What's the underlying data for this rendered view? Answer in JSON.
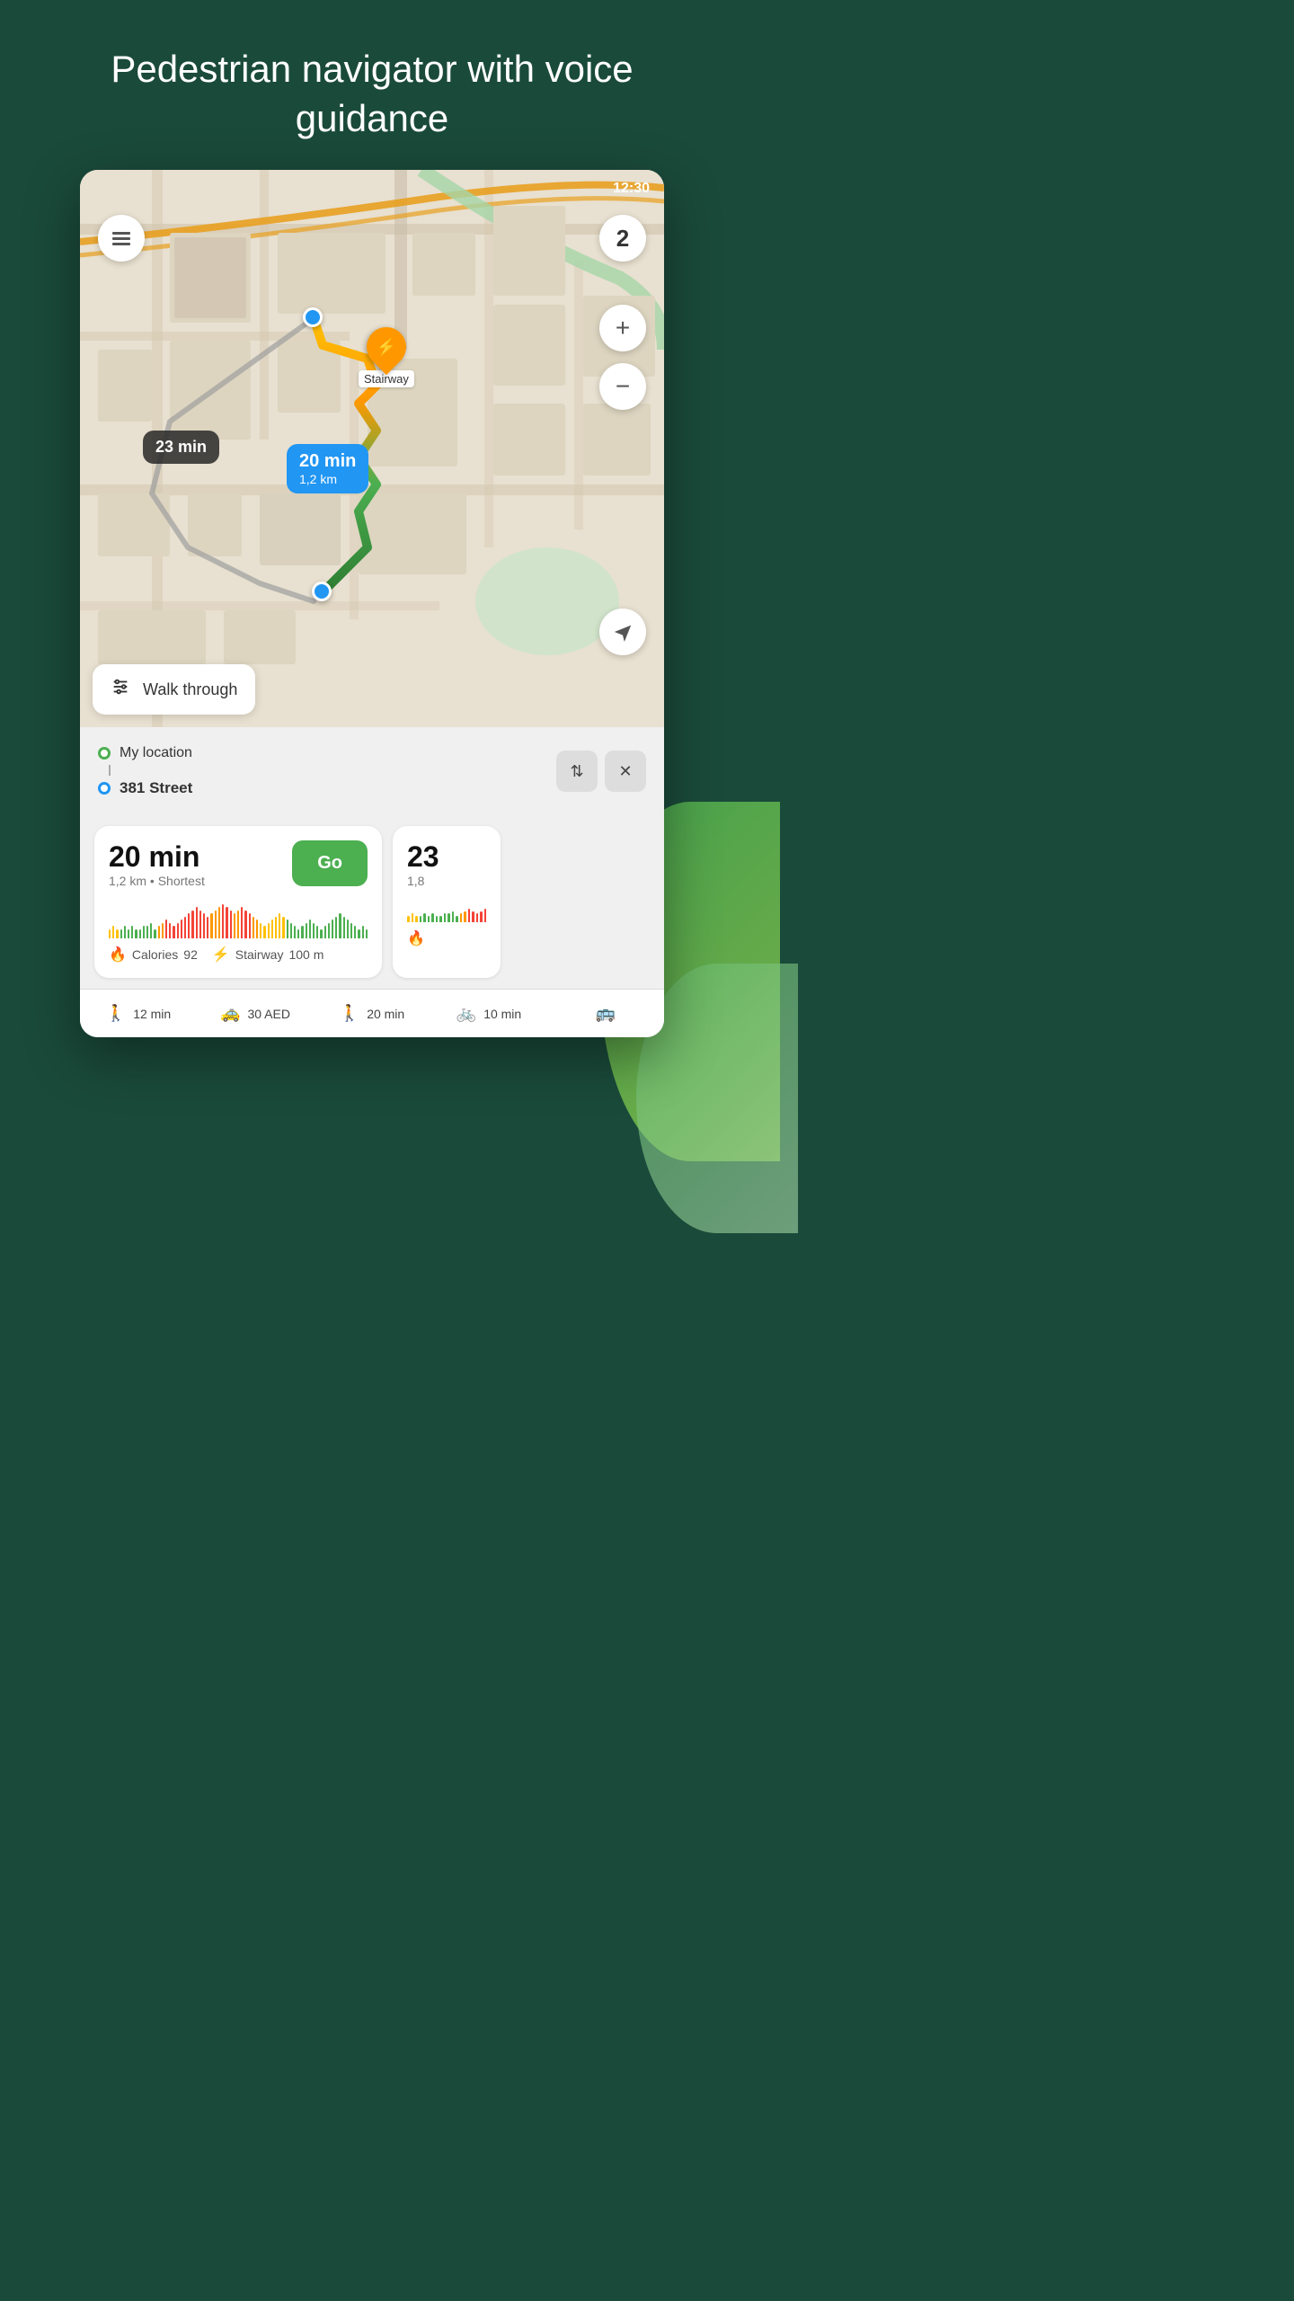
{
  "header": {
    "title": "Pedestrian navigator with voice guidance"
  },
  "map": {
    "time": "12:30",
    "stepsCount": "2",
    "stairwayLabel": "Stairway",
    "darkBubble": "23 min",
    "blueBubble": {
      "time": "20 min",
      "distance": "1,2 km"
    },
    "walkThroughLabel": "Walk through",
    "zoomPlus": "+",
    "zoomMinus": "−"
  },
  "routePanel": {
    "from": "My location",
    "to": "381 Street",
    "swapLabel": "⇅",
    "closeLabel": "✕"
  },
  "routeCard": {
    "duration": "20 min",
    "info": "1,2 km • Shortest",
    "goLabel": "Go",
    "calories": "92",
    "caloriesLabel": "Calories",
    "stairwayDist": "100 m",
    "stairwayLabel": "Stairway"
  },
  "routeCard2": {
    "duration": "23",
    "info": "1,8"
  },
  "bottomNav": {
    "tab1": {
      "label": "12 min",
      "icon": "🚶"
    },
    "tab2": {
      "label": "30 AED",
      "icon": "🚕"
    },
    "tab3": {
      "label": "20 min",
      "icon": "🚶"
    },
    "tab4": {
      "label": "10 min",
      "icon": "🚲"
    },
    "tab5": {
      "label": "",
      "icon": "🚌"
    }
  },
  "elevation": {
    "bars": [
      3,
      4,
      3,
      3,
      4,
      3,
      4,
      3,
      3,
      4,
      4,
      5,
      3,
      4,
      5,
      6,
      5,
      4,
      5,
      6,
      7,
      8,
      9,
      10,
      9,
      8,
      7,
      8,
      9,
      10,
      11,
      10,
      9,
      8,
      9,
      10,
      9,
      8,
      7,
      6,
      5,
      4,
      5,
      6,
      7,
      8,
      7,
      6,
      5,
      4,
      3,
      4,
      5,
      6,
      5,
      4,
      3,
      4,
      5,
      6,
      7,
      8,
      7,
      6,
      5,
      4,
      3,
      4,
      3
    ],
    "colors": [
      "#ffc107",
      "#ffc107",
      "#ffc107",
      "#4caf50",
      "#4caf50",
      "#4caf50",
      "#4caf50",
      "#4caf50",
      "#4caf50",
      "#4caf50",
      "#4caf50",
      "#4caf50",
      "#4caf50",
      "#ff9800",
      "#ff9800",
      "#f44336",
      "#f44336",
      "#f44336",
      "#f44336",
      "#f44336",
      "#f44336",
      "#f44336",
      "#f44336",
      "#f44336",
      "#f44336",
      "#f44336",
      "#f44336",
      "#ff9800",
      "#ff9800",
      "#ff9800",
      "#f44336",
      "#f44336",
      "#f44336",
      "#ff9800",
      "#ff9800",
      "#f44336",
      "#f44336",
      "#f44336",
      "#ff9800",
      "#ff9800",
      "#ffc107",
      "#ffc107",
      "#ffc107",
      "#ffc107",
      "#ffc107",
      "#ffc107",
      "#ffc107",
      "#4caf50",
      "#4caf50",
      "#4caf50",
      "#4caf50",
      "#4caf50",
      "#4caf50",
      "#4caf50",
      "#4caf50",
      "#4caf50",
      "#4caf50",
      "#4caf50",
      "#4caf50",
      "#4caf50",
      "#4caf50",
      "#4caf50",
      "#4caf50",
      "#4caf50",
      "#4caf50",
      "#4caf50",
      "#4caf50",
      "#4caf50",
      "#4caf50",
      "#4caf50"
    ]
  }
}
